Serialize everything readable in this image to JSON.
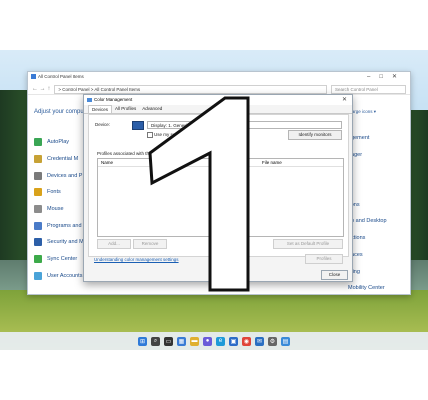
{
  "control_panel": {
    "title": "All Control Panel Items",
    "nav": "← → ↑",
    "path": "> Control Panel  >  All Control Panel Items",
    "search_placeholder": "Search Control Panel",
    "heading": "Adjust your comput",
    "view_by": "Large icons ▾",
    "left_items": [
      {
        "label": "AutoPlay",
        "color": "#3aa655"
      },
      {
        "label": "Credential M",
        "color": "#c7a235"
      },
      {
        "label": "Devices and P",
        "color": "#7a7a7a"
      },
      {
        "label": "Fonts",
        "color": "#d9a21b"
      },
      {
        "label": "Mouse",
        "color": "#8c8c8c"
      },
      {
        "label": "Programs and",
        "color": "#4a7bc8"
      },
      {
        "label": "Security and M",
        "color": "#2d5fa8"
      },
      {
        "label": "Sync Center",
        "color": "#3daa4a"
      },
      {
        "label": "User Accounts",
        "color": "#4aa3d8"
      }
    ],
    "right_items": [
      "agement",
      "nager",
      "y",
      "",
      "tions",
      "up and Desktop",
      "ections",
      "paces",
      "oting",
      "Mobility Center"
    ]
  },
  "dialog": {
    "title": "Color Management",
    "tabs": [
      "Devices",
      "All Profiles",
      "Advanced"
    ],
    "device_label": "Device:",
    "device_value": "Display: 1. Generic Non-PnP Monitor - ... 3D",
    "use_settings_label": "Use my settings for this device",
    "identify_button": "Identify monitors",
    "profiles_label": "Profiles associated with this device:",
    "col_name": "Name",
    "col_file": "File name",
    "add_button": "Add...",
    "remove_button": "Remove",
    "default_button": "Set as Default Profile",
    "link": "Understanding color management settings",
    "profiles_button": "Profiles",
    "close_button": "Close"
  },
  "overlay": {
    "digit": "1"
  },
  "taskbar": {
    "icons": [
      {
        "name": "start-icon",
        "color": "#2f7ad8",
        "glyph": "⊞"
      },
      {
        "name": "search-icon",
        "color": "#444444",
        "glyph": "⌕"
      },
      {
        "name": "task-view-icon",
        "color": "#333333",
        "glyph": "▭"
      },
      {
        "name": "widgets-icon",
        "color": "#3a7bd5",
        "glyph": "▦"
      },
      {
        "name": "file-explorer-icon",
        "color": "#e0b030",
        "glyph": "▬"
      },
      {
        "name": "chat-icon",
        "color": "#6b5bd8",
        "glyph": "●"
      },
      {
        "name": "edge-icon",
        "color": "#1f9ad8",
        "glyph": "e"
      },
      {
        "name": "store-icon",
        "color": "#2d6cc8",
        "glyph": "▣"
      },
      {
        "name": "chrome-icon",
        "color": "#e0453a",
        "glyph": "◉"
      },
      {
        "name": "mail-icon",
        "color": "#2a6fc2",
        "glyph": "✉"
      },
      {
        "name": "settings-icon",
        "color": "#666666",
        "glyph": "⚙"
      },
      {
        "name": "control-panel-icon",
        "color": "#3a8ad8",
        "glyph": "▤"
      }
    ]
  }
}
